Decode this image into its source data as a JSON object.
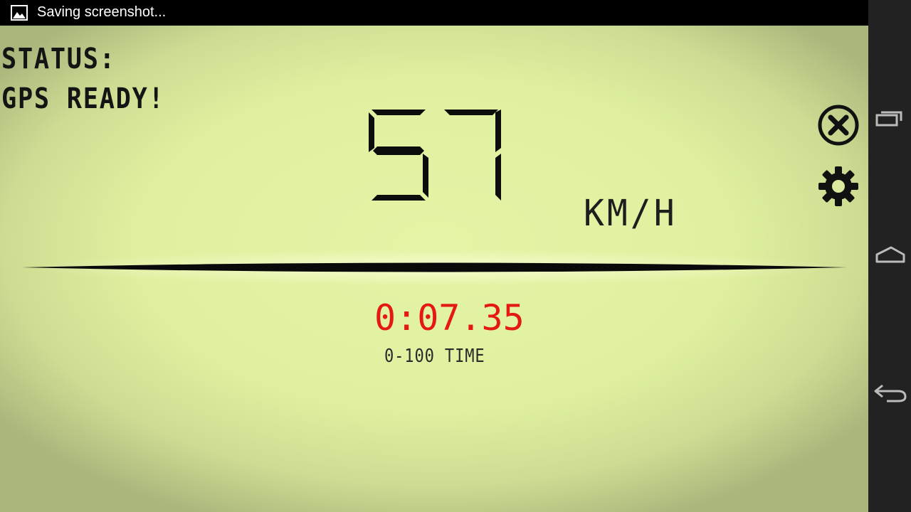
{
  "statusbar": {
    "notification_icon": "image-icon",
    "notification_text": "Saving screenshot..."
  },
  "speedometer": {
    "status_label": "STATUS:",
    "status_value": "GPS READY!",
    "speed": "57",
    "unit": "KM/H",
    "timer_value": "0:07.35",
    "timer_label": "0-100 TIME",
    "timer_color": "#e41a12",
    "lcd_color": "#e2f3a4",
    "digit_color": "#0d0d0d"
  },
  "actions": {
    "close_icon": "close-circle-icon",
    "settings_icon": "gear-icon"
  },
  "navbar": {
    "recent_icon": "recent-apps-icon",
    "home_icon": "home-icon",
    "back_icon": "back-icon"
  }
}
